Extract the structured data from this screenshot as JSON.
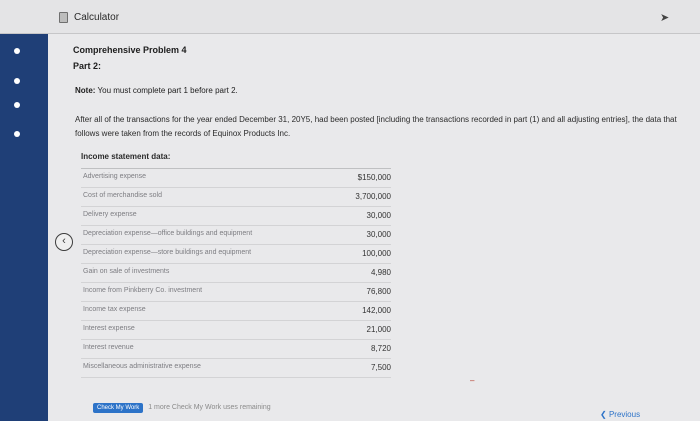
{
  "window": {
    "title": "Calculator"
  },
  "sidebar": {
    "dots": [
      1,
      2,
      3,
      4
    ]
  },
  "problem": {
    "title": "Comprehensive Problem 4",
    "part": "Part 2:",
    "note_label": "Note:",
    "note_text": " You must complete part 1 before part 2.",
    "paragraph": "After all of the transactions for the year ended December 31, 20Y5, had been posted [including the transactions recorded in part (1) and all adjusting entries], the data that follows were taken from the records of Equinox Products Inc."
  },
  "table": {
    "header": "Income statement data:",
    "rows": [
      {
        "label": "Advertising expense",
        "value": "$150,000"
      },
      {
        "label": "Cost of merchandise sold",
        "value": "3,700,000"
      },
      {
        "label": "Delivery expense",
        "value": "30,000"
      },
      {
        "label": "Depreciation expense—office buildings and equipment",
        "value": "30,000"
      },
      {
        "label": "Depreciation expense—store buildings and equipment",
        "value": "100,000"
      },
      {
        "label": "Gain on sale of investments",
        "value": "4,980"
      },
      {
        "label": "Income from Pinkberry Co. investment",
        "value": "76,800"
      },
      {
        "label": "Income tax expense",
        "value": "142,000"
      },
      {
        "label": "Interest expense",
        "value": "21,000"
      },
      {
        "label": "Interest revenue",
        "value": "8,720"
      },
      {
        "label": "Miscellaneous administrative expense",
        "value": "7,500"
      }
    ]
  },
  "footer": {
    "check_label": "Check My Work",
    "remaining_text": "1 more Check My Work uses remaining",
    "previous_label": "Previous"
  },
  "icons": {
    "back": "chevron-left-icon",
    "calculator": "calculator-icon"
  }
}
